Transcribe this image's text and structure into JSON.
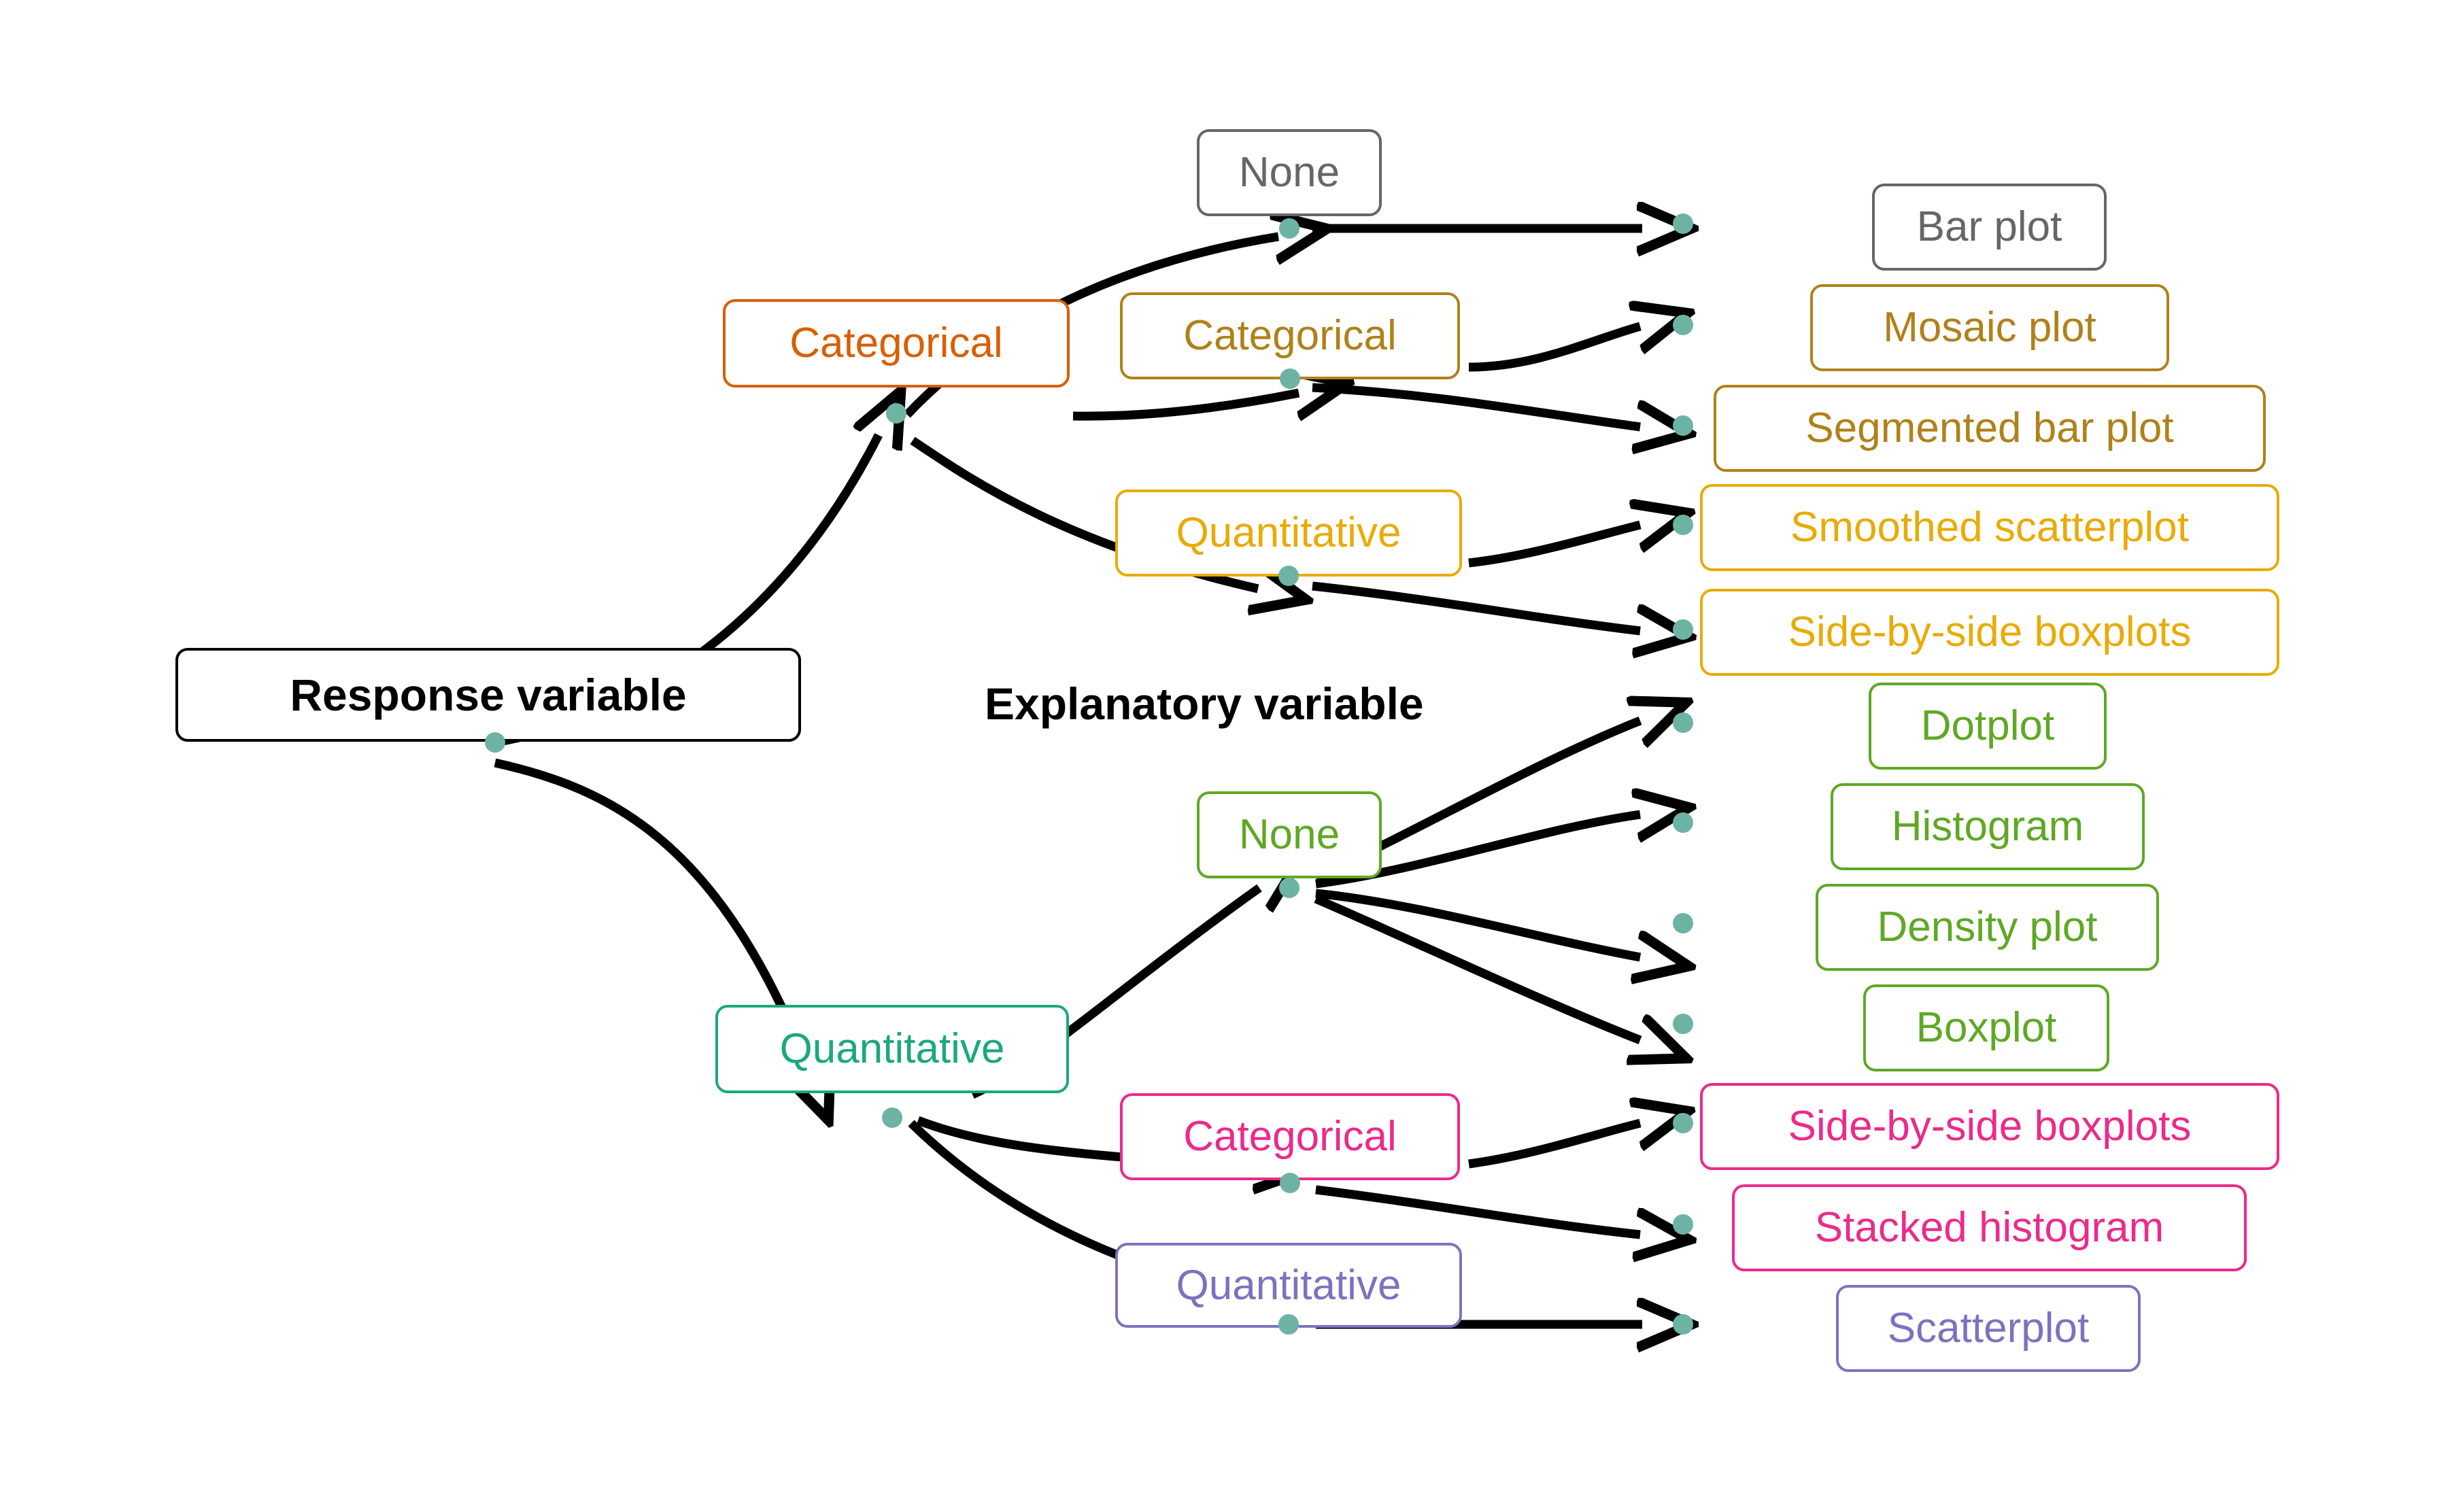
{
  "diagram": {
    "title_root": "Response variable",
    "title_explanatory": "Explanatory variable",
    "colors": {
      "black": "#000000",
      "gray": "#666666",
      "orange": "#D95F02",
      "brown": "#B0811A",
      "gold": "#E8AB07",
      "green": "#5FA825",
      "teal": "#1BA87E",
      "pink": "#EC2A8B",
      "purple": "#7C73BE",
      "anchor_dot": "#6DB3A3",
      "edge": "#000000"
    },
    "nodes": {
      "root": {
        "label": "Response variable",
        "color": "#000000"
      },
      "explanatory_label": {
        "label": "Explanatory variable",
        "color": "#000000"
      },
      "resp_categorical": {
        "label": "Categorical",
        "color": "#D95F02"
      },
      "resp_quantitative": {
        "label": "Quantitative",
        "color": "#1BA87E"
      },
      "expl_none_gray": {
        "label": "None",
        "color": "#666666"
      },
      "expl_categorical_brown": {
        "label": "Categorical",
        "color": "#B0811A"
      },
      "expl_quantitative_gold": {
        "label": "Quantitative",
        "color": "#E8AB07"
      },
      "expl_none_green": {
        "label": "None",
        "color": "#5FA825"
      },
      "expl_categorical_pink": {
        "label": "Categorical",
        "color": "#EC2A8B"
      },
      "expl_quantitative_purple": {
        "label": "Quantitative",
        "color": "#7C73BE"
      }
    },
    "plots": [
      {
        "id": "bar-plot",
        "label": "Bar plot",
        "color": "#666666"
      },
      {
        "id": "mosaic-plot",
        "label": "Mosaic plot",
        "color": "#B0811A"
      },
      {
        "id": "segmented-bar-plot",
        "label": "Segmented bar plot",
        "color": "#B0811A"
      },
      {
        "id": "smoothed-scatterplot",
        "label": "Smoothed scatterplot",
        "color": "#E8AB07"
      },
      {
        "id": "side-by-side-boxplots-gold",
        "label": "Side-by-side boxplots",
        "color": "#E8AB07"
      },
      {
        "id": "dotplot",
        "label": "Dotplot",
        "color": "#5FA825"
      },
      {
        "id": "histogram",
        "label": "Histogram",
        "color": "#5FA825"
      },
      {
        "id": "density-plot",
        "label": "Density plot",
        "color": "#5FA825"
      },
      {
        "id": "boxplot",
        "label": "Boxplot",
        "color": "#5FA825"
      },
      {
        "id": "side-by-side-boxplots-pink",
        "label": "Side-by-side boxplots",
        "color": "#EC2A8B"
      },
      {
        "id": "stacked-histogram",
        "label": "Stacked histogram",
        "color": "#EC2A8B"
      },
      {
        "id": "scatterplot",
        "label": "Scatterplot",
        "color": "#7C73BE"
      }
    ],
    "edges": [
      {
        "from": "Response variable",
        "to": "Categorical (response)"
      },
      {
        "from": "Response variable",
        "to": "Quantitative (response)"
      },
      {
        "from": "Categorical (response)",
        "to": "None (gray)"
      },
      {
        "from": "Categorical (response)",
        "to": "Categorical (brown)"
      },
      {
        "from": "Categorical (response)",
        "to": "Quantitative (gold)"
      },
      {
        "from": "None (gray)",
        "to": "Bar plot"
      },
      {
        "from": "Categorical (brown)",
        "to": "Mosaic plot"
      },
      {
        "from": "Categorical (brown)",
        "to": "Segmented bar plot"
      },
      {
        "from": "Quantitative (gold)",
        "to": "Smoothed scatterplot"
      },
      {
        "from": "Quantitative (gold)",
        "to": "Side-by-side boxplots"
      },
      {
        "from": "Quantitative (response)",
        "to": "None (green)"
      },
      {
        "from": "Quantitative (response)",
        "to": "Categorical (pink)"
      },
      {
        "from": "Quantitative (response)",
        "to": "Quantitative (purple)"
      },
      {
        "from": "None (green)",
        "to": "Dotplot"
      },
      {
        "from": "None (green)",
        "to": "Histogram"
      },
      {
        "from": "None (green)",
        "to": "Density plot"
      },
      {
        "from": "None (green)",
        "to": "Boxplot"
      },
      {
        "from": "Categorical (pink)",
        "to": "Side-by-side boxplots"
      },
      {
        "from": "Categorical (pink)",
        "to": "Stacked histogram"
      },
      {
        "from": "Quantitative (purple)",
        "to": "Scatterplot"
      }
    ]
  }
}
